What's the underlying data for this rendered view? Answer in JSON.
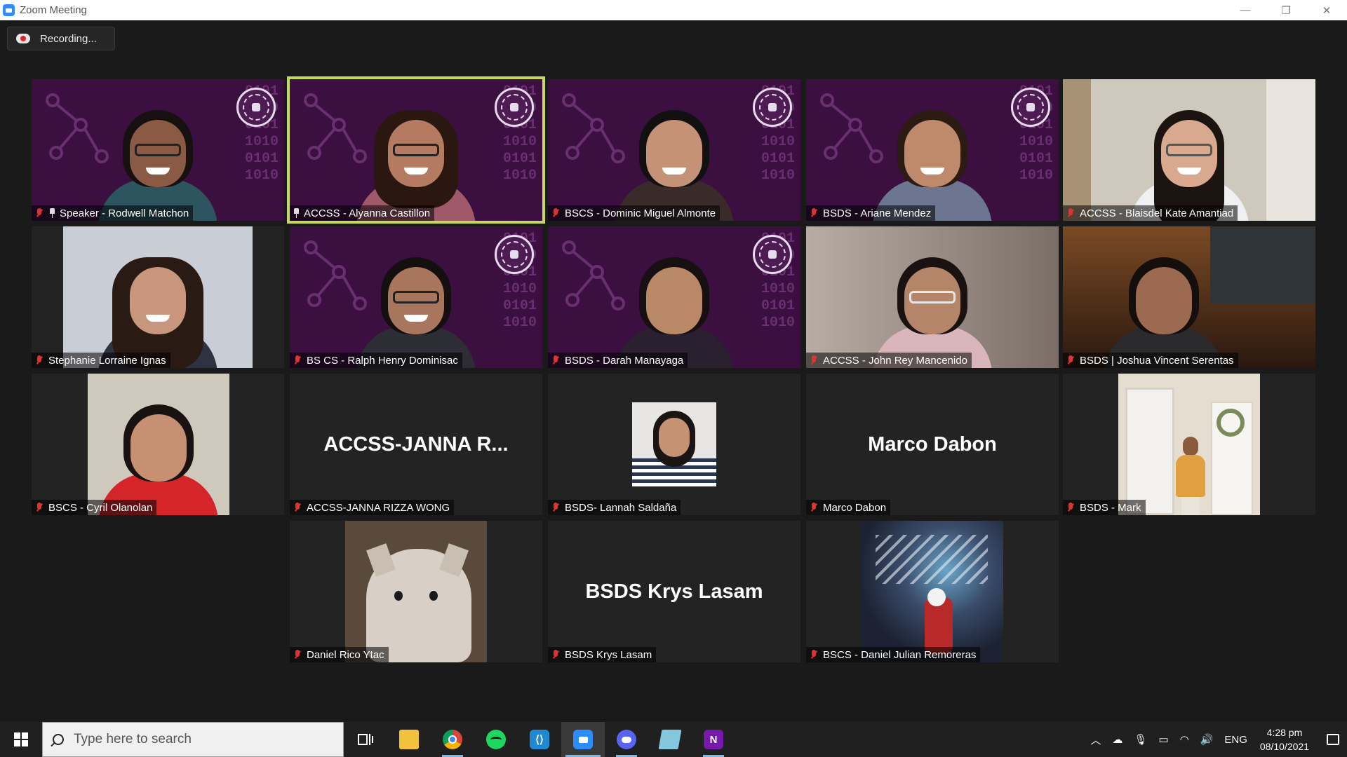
{
  "window": {
    "title": "Zoom Meeting",
    "controls": [
      "—",
      "❐",
      "✕"
    ]
  },
  "recording": {
    "label": "Recording..."
  },
  "tiles": [
    {
      "name": "Speaker - Rodwell Matchon",
      "pinned": true,
      "muted": true
    },
    {
      "name": "ACCSS - Alyanna Castillon",
      "pinned": true,
      "muted": false,
      "active_speaker": true
    },
    {
      "name": "BSCS - Dominic Miguel Almonte",
      "muted": true
    },
    {
      "name": "BSDS - Ariane Mendez",
      "muted": true
    },
    {
      "name": "ACCSS - Blaisdel Kate Amantiad",
      "muted": true
    },
    {
      "name": "Stephanie Lorraine Ignas",
      "muted": true
    },
    {
      "name": "BS CS - Ralph Henry Dominisac",
      "muted": true
    },
    {
      "name": "BSDS - Darah Manayaga",
      "muted": true
    },
    {
      "name": "ACCSS - John Rey Mancenido",
      "muted": true
    },
    {
      "name": "BSDS | Joshua Vincent Serentas",
      "muted": true
    },
    {
      "name": "BSCS - Cyril Olanolan",
      "muted": true
    },
    {
      "name": "ACCSS-JANNA RIZZA WONG",
      "display": "ACCSS-JANNA  R...",
      "muted": true
    },
    {
      "name": "BSDS- Lannah Saldaña",
      "muted": true
    },
    {
      "name": "Marco Dabon",
      "display": "Marco Dabon",
      "muted": true
    },
    {
      "name": "BSDS - Mark",
      "muted": true
    },
    {
      "name": "Daniel Rico Ytac",
      "muted": true
    },
    {
      "name": "BSDS Krys Lasam",
      "display": "BSDS Krys Lasam",
      "muted": true
    },
    {
      "name": "BSCS - Daniel Julian Remoreras",
      "muted": true
    }
  ],
  "background": {
    "binary_text": "0101\n1010\n0101\n1010\n0101\n1010"
  },
  "taskbar": {
    "search_placeholder": "Type here to search",
    "apps": [
      "task-view",
      "file-explorer",
      "chrome",
      "spotify",
      "vscode",
      "zoom",
      "discord",
      "notepad",
      "onenote"
    ],
    "language": "ENG",
    "time": "4:28 pm",
    "date": "08/10/2021"
  },
  "colors": {
    "active_speaker_border": "#c8d85a",
    "purple_bg": "#3b0f3f",
    "mute_red": "#e13232",
    "taskbar": "#202020"
  }
}
